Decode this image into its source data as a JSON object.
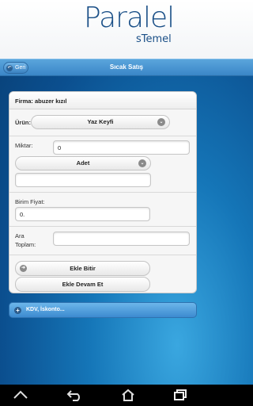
{
  "logo": {
    "main": "Paralel",
    "sub": "sTemel"
  },
  "header": {
    "back_label": "Geri",
    "title": "Sıcak Satış"
  },
  "form": {
    "firma_label": "Firma: abuzer kızıl",
    "urun_label": "Ürün:",
    "urun_value": "Yaz Keyfi",
    "miktar_label": "Miktar:",
    "miktar_value": "0",
    "unit_value": "Adet",
    "unit_extra_value": "",
    "birim_fiyat_label": "Birim Fiyat:",
    "birim_fiyat_value": "0.",
    "ara_label_1": "Ara",
    "ara_label_2": "Toplam:",
    "ara_toplam_value": "",
    "ekle_bitir_label": "Ekle Bitir",
    "ekle_devam_label": "Ekle Devam Et"
  },
  "collapsible": {
    "label": "KDV, İskonto..."
  },
  "icons": {
    "back": "back-arrow-icon",
    "chevron": "chevron-down-icon",
    "plus": "plus-icon",
    "nav_up": "nav-up-icon",
    "nav_back": "nav-back-icon",
    "nav_home": "nav-home-icon",
    "nav_recent": "nav-recent-apps-icon"
  },
  "colors": {
    "header": "#3a86c7",
    "logo": "#1a4f87",
    "background": "#0b4f8f"
  }
}
